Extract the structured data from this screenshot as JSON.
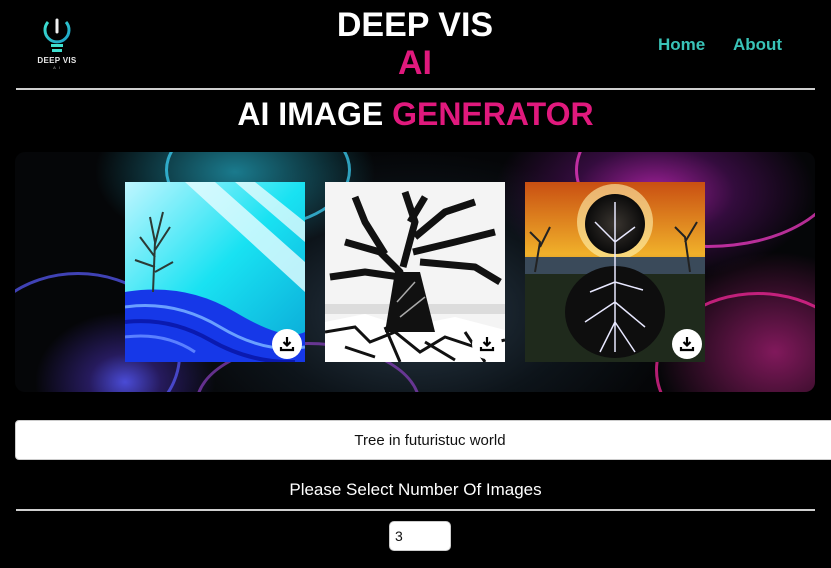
{
  "header": {
    "logo_text": "DEEP VIS",
    "logo_sub": "A I",
    "brand_line1": "DEEP VIS",
    "brand_line2": "AI",
    "nav": [
      {
        "label": "Home"
      },
      {
        "label": "About"
      }
    ]
  },
  "page": {
    "title_part1": "AI IMAGE",
    "title_part2": "GENERATOR"
  },
  "gallery": {
    "images": [
      {
        "alt": "Generated image 1",
        "download_icon": "download-icon"
      },
      {
        "alt": "Generated image 2",
        "download_icon": "download-icon"
      },
      {
        "alt": "Generated image 3",
        "download_icon": "download-icon"
      }
    ]
  },
  "form": {
    "prompt_value": "Tree in futuristuc world",
    "select_label": "Please Select Number Of Images",
    "count_value": "3"
  },
  "colors": {
    "accent_pink": "#e0197d",
    "accent_teal": "#39c3b8",
    "background": "#000000"
  }
}
